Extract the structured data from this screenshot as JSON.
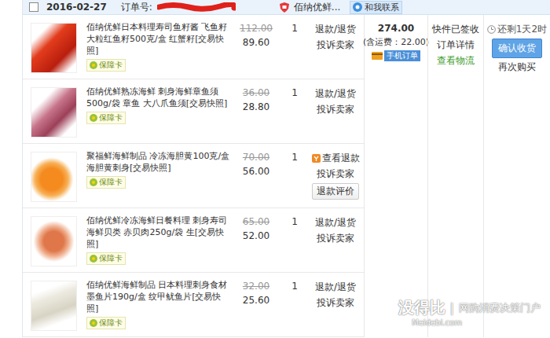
{
  "order": {
    "checked": false,
    "date": "2016-02-27",
    "order_label": "订单号:",
    "shop": "佰纳优鲜...",
    "contact": "和我联系"
  },
  "items": [
    {
      "title": "佰纳优鲜日本料理寿司鱼籽酱 飞鱼籽 大粒红鱼籽500克/盒 红蟹籽",
      "snapshot": "[交易快照]",
      "badge": "保障卡",
      "original_price": "112.00",
      "price": "89.60",
      "quantity": "1",
      "actions": [
        {
          "label": "退款/退货",
          "kind": "link"
        },
        {
          "label": "投诉卖家",
          "kind": "link"
        }
      ]
    },
    {
      "title": "佰纳优鲜熟冻海鲜 刺身海鲜章鱼须 500g/袋 章鱼 大八爪鱼须",
      "snapshot": "[交易快照]",
      "badge": "保障卡",
      "original_price": "36.00",
      "price": "28.80",
      "quantity": "1",
      "actions": [
        {
          "label": "退款/退货",
          "kind": "link"
        },
        {
          "label": "投诉卖家",
          "kind": "link"
        }
      ]
    },
    {
      "title": "聚福鲜海鲜制品 冷冻海胆黄100克/盒 海胆黄刺身",
      "snapshot": "[交易快照]",
      "badge": "保障卡",
      "original_price": "70.00",
      "price": "56.00",
      "quantity": "1",
      "actions": [
        {
          "label": "查看退款",
          "kind": "refund"
        },
        {
          "label": "投诉卖家",
          "kind": "link"
        },
        {
          "label": "退款评价",
          "kind": "button"
        }
      ]
    },
    {
      "title": "佰纳优鲜冷冻海鲜日餐料理 刺身寿司 海鲜贝类 赤贝肉250g/袋 生",
      "snapshot": "[交易快照]",
      "badge": "保障卡",
      "original_price": "65.00",
      "price": "52.00",
      "quantity": "1",
      "actions": [
        {
          "label": "退款/退货",
          "kind": "link"
        },
        {
          "label": "投诉卖家",
          "kind": "link"
        }
      ]
    },
    {
      "title": "佰纳优鲜海鲜制品 日本料理刺身食材 墨鱼片190g/盒 纹甲鱿鱼片",
      "snapshot": "[交易快照]",
      "badge": "保障卡",
      "original_price": "32.00",
      "price": "25.60",
      "quantity": "1",
      "actions": [
        {
          "label": "退款/退货",
          "kind": "link"
        },
        {
          "label": "投诉卖家",
          "kind": "link"
        }
      ]
    }
  ],
  "summary": {
    "total": "274.00",
    "shipping": "(含运费：22.00)",
    "mobile_badge": "手机订单"
  },
  "status": {
    "text": "快件已签收",
    "links": [
      "订单详情",
      "查看物流"
    ]
  },
  "operations": {
    "countdown": "还剩1天2时",
    "confirm": "确认收货",
    "rebuy": "再次购买"
  },
  "watermark": {
    "logo": "没得比",
    "separator": "|",
    "slogan": "网购消费决策门户",
    "url": "Meidebi.com"
  }
}
